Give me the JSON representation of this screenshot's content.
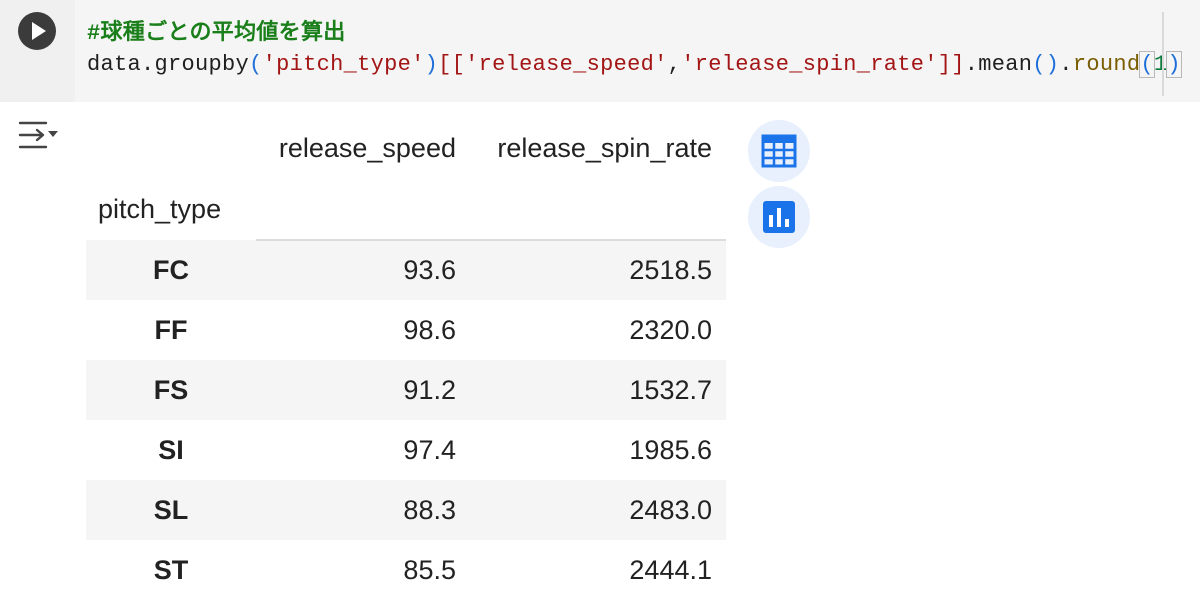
{
  "code_cell": {
    "run_button_icon": "play-icon",
    "comment": "#球種ごとの平均値を算出",
    "tokens": {
      "obj": "data",
      "dot1": ".",
      "method1": "groupby",
      "paren_open": "(",
      "arg_str": "'pitch_type'",
      "paren_close": ")",
      "bracket_open": "[[",
      "col1": "'release_speed'",
      "comma": ",",
      "col2": "'release_spin_rate'",
      "bracket_close": "]]",
      "dot2": ".",
      "method2": "mean",
      "call_parens": "()",
      "dot3": ".",
      "method3": "round",
      "rp_open": "(",
      "round_arg": "1",
      "rp_close": ")"
    }
  },
  "output": {
    "output_icon": "output-toggle-icon",
    "dataframe": {
      "columns": [
        "release_speed",
        "release_spin_rate"
      ],
      "index_name": "pitch_type",
      "rows": [
        {
          "index": "FC",
          "release_speed": "93.6",
          "release_spin_rate": "2518.5"
        },
        {
          "index": "FF",
          "release_speed": "98.6",
          "release_spin_rate": "2320.0"
        },
        {
          "index": "FS",
          "release_speed": "91.2",
          "release_spin_rate": "1532.7"
        },
        {
          "index": "SI",
          "release_speed": "97.4",
          "release_spin_rate": "1985.6"
        },
        {
          "index": "SL",
          "release_speed": "88.3",
          "release_spin_rate": "2483.0"
        },
        {
          "index": "ST",
          "release_speed": "85.5",
          "release_spin_rate": "2444.1"
        }
      ]
    },
    "toolbar": {
      "table_icon": "table-icon",
      "chart_icon": "bar-chart-icon"
    }
  },
  "colors": {
    "accent_blue": "#1a73e8",
    "tool_bg": "#e8f0fe",
    "comment_green": "#1a7f1a",
    "string_red": "#a31515"
  }
}
